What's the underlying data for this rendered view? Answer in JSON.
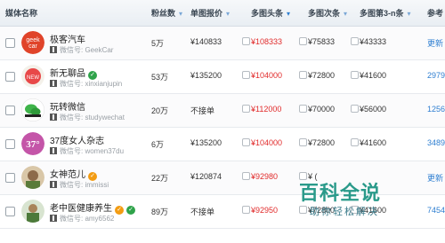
{
  "header": {
    "media_name": "媒体名称",
    "fans": "粉丝数",
    "price": "单图报价",
    "head": "多图头条",
    "second": "多图次条",
    "third": "多图第3-n条",
    "ref": "参考"
  },
  "rows": [
    {
      "name": "极客汽车",
      "wechat": "微信号: GeekCar",
      "fans": "5万",
      "price": "¥140833",
      "head": "¥108333",
      "second": "¥75833",
      "third": "¥43333",
      "ref": "更新"
    },
    {
      "name": "新无聊品",
      "wechat": "微信号: xinxianjupin",
      "fans": "53万",
      "price": "¥135200",
      "head": "¥104000",
      "second": "¥72800",
      "third": "¥41600",
      "ref": "2979"
    },
    {
      "name": "玩转微信",
      "wechat": "微信号: studywechat",
      "fans": "20万",
      "price": "不接单",
      "head": "¥112000",
      "second": "¥70000",
      "third": "¥56000",
      "ref": "1256"
    },
    {
      "name": "37度女人杂志",
      "wechat": "微信号: women37du",
      "fans": "6万",
      "price": "¥135200",
      "head": "¥104000",
      "second": "¥72800",
      "third": "¥41600",
      "ref": "3489"
    },
    {
      "name": "女神范儿",
      "wechat": "微信号: immissi",
      "fans": "22万",
      "price": "¥120874",
      "head": "¥92980",
      "second": "¥ (",
      "third": "",
      "ref": "更新"
    },
    {
      "name": "老中医健康养生",
      "wechat": "微信号: amy6562",
      "fans": "89万",
      "price": "不接单",
      "head": "¥92950",
      "second": "¥72800",
      "third": "¥41600",
      "ref": "7454"
    }
  ],
  "watermark": {
    "title": "百科全说",
    "subtitle": "助你轻松解决"
  },
  "colors": {
    "header_bg": "#eef2f6",
    "price_red": "#e12b2b",
    "link_blue": "#2f7fd1",
    "watermark": "#2a9a8a"
  }
}
